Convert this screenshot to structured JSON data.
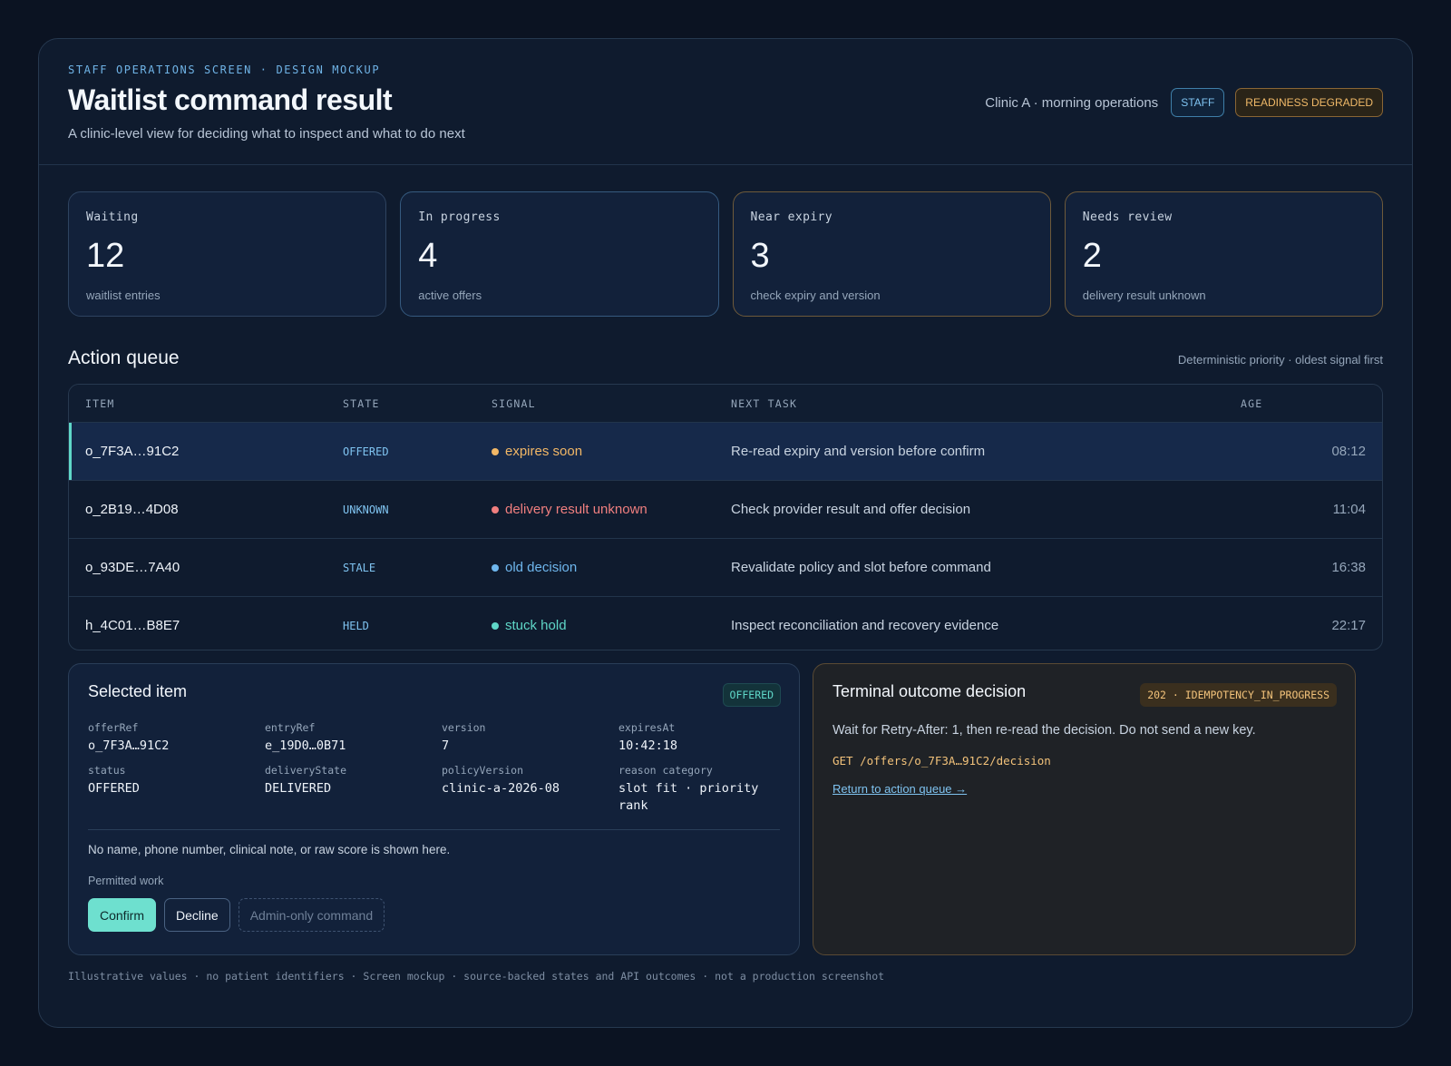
{
  "header": {
    "eyebrow": "STAFF OPERATIONS SCREEN · DESIGN MOCKUP",
    "title": "Waitlist command result",
    "subtitle": "A clinic-level view for deciding what to inspect and what to do next",
    "clinic": "Clinic A · morning operations",
    "role_badge": "STAFF",
    "readiness_badge": "READINESS DEGRADED"
  },
  "stats": [
    {
      "label": "Waiting",
      "value": "12",
      "desc": "waitlist entries"
    },
    {
      "label": "In progress",
      "value": "4",
      "desc": "active offers"
    },
    {
      "label": "Near expiry",
      "value": "3",
      "desc": "check expiry and version"
    },
    {
      "label": "Needs review",
      "value": "2",
      "desc": "delivery result unknown"
    }
  ],
  "queue": {
    "title": "Action queue",
    "note": "Deterministic priority · oldest signal first",
    "columns": {
      "item": "ITEM",
      "state": "STATE",
      "signal": "SIGNAL",
      "next": "NEXT TASK",
      "age": "AGE"
    },
    "rows": [
      {
        "item": "o_7F3A…91C2",
        "state": "OFFERED",
        "signal": "expires soon",
        "signal_color": "#f2b766",
        "next": "Re-read expiry and version before confirm",
        "age": "08:12"
      },
      {
        "item": "o_2B19…4D08",
        "state": "UNKNOWN",
        "signal": "delivery result unknown",
        "signal_color": "#f07f7f",
        "next": "Check provider result and offer decision",
        "age": "11:04"
      },
      {
        "item": "o_93DE…7A40",
        "state": "STALE",
        "signal": "old decision",
        "signal_color": "#6fb7ee",
        "next": "Revalidate policy and slot before command",
        "age": "16:38"
      },
      {
        "item": "h_4C01…B8E7",
        "state": "HELD",
        "signal": "stuck hold",
        "signal_color": "#5fd7c8",
        "next": "Inspect reconciliation and recovery evidence",
        "age": "22:17"
      }
    ]
  },
  "selected": {
    "title": "Selected item",
    "badge": "OFFERED",
    "fields": [
      {
        "label": "offerRef",
        "value": "o_7F3A…91C2"
      },
      {
        "label": "entryRef",
        "value": "e_19D0…0B71"
      },
      {
        "label": "version",
        "value": "7"
      },
      {
        "label": "expiresAt",
        "value": "10:42:18"
      },
      {
        "label": "status",
        "value": "OFFERED"
      },
      {
        "label": "deliveryState",
        "value": "DELIVERED"
      },
      {
        "label": "policyVersion",
        "value": "clinic-a-2026-08"
      },
      {
        "label": "reason category",
        "value": "slot fit · priority rank"
      }
    ],
    "privacy_note": "No name, phone number, clinical note, or raw score is shown here.",
    "permitted_label": "Permitted work",
    "buttons": {
      "confirm": "Confirm",
      "decline": "Decline",
      "admin": "Admin-only command"
    }
  },
  "outcome": {
    "title": "Terminal outcome decision",
    "code": "202 · IDEMPOTENCY_IN_PROGRESS",
    "text": "Wait for Retry-After: 1, then re-read the decision. Do not send a new key.",
    "endpoint": "GET /offers/o_7F3A…91C2/decision",
    "link": "Return to action queue →"
  },
  "footer": "Illustrative values · no patient identifiers · Screen mockup · source-backed states and API outcomes · not a production screenshot"
}
